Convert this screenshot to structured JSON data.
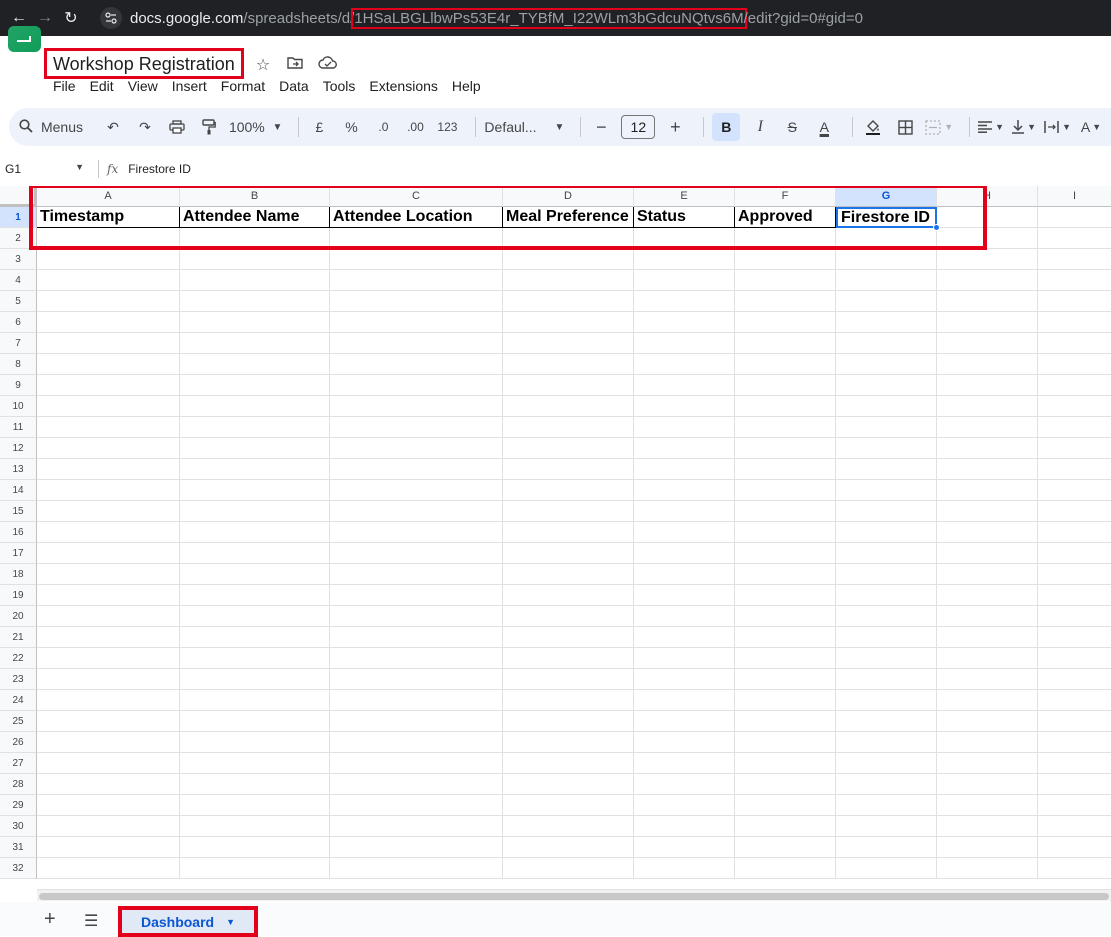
{
  "browser": {
    "url_host": "docs.google.com",
    "url_path_prefix": "/spreadsheets/d/",
    "url_doc_id": "1HSaLBGLlbwPs53E4r_TYBfM_I22WLm3bGdcuNQtvs6M",
    "url_suffix": "/edit?gid=0#gid=0"
  },
  "doc": {
    "title": "Workshop Registration"
  },
  "menu": [
    "File",
    "Edit",
    "View",
    "Insert",
    "Format",
    "Data",
    "Tools",
    "Extensions",
    "Help"
  ],
  "toolbar": {
    "menus_label": "Menus",
    "zoom": "100%",
    "currency": "£",
    "percent": "%",
    "dec_decrease": ".0",
    "dec_increase": ".00",
    "number_format": "123",
    "font": "Defaul...",
    "font_size": "12",
    "bold": "B",
    "italic": "I",
    "strike": "S",
    "text_color": "A"
  },
  "formula_bar": {
    "cell_ref": "G1",
    "fx": "fx",
    "content": "Firestore ID"
  },
  "columns": [
    "A",
    "B",
    "C",
    "D",
    "E",
    "F",
    "G",
    "H",
    "I"
  ],
  "selected_column": "G",
  "rows": [
    "1",
    "2",
    "3",
    "4",
    "5",
    "6",
    "7",
    "8",
    "9",
    "10",
    "11",
    "12",
    "13",
    "14",
    "15",
    "16",
    "17",
    "18",
    "19",
    "20",
    "21",
    "22",
    "23",
    "24",
    "25",
    "26",
    "27",
    "28",
    "29",
    "30",
    "31",
    "32"
  ],
  "header_row": [
    "Timestamp",
    "Attendee Name",
    "Attendee Location",
    "Meal Preference",
    "Status",
    "Approved",
    "Firestore ID"
  ],
  "sheet": {
    "tab_label": "Dashboard"
  },
  "colors": {
    "highlight": "#e3001b",
    "accent": "#1a73e8",
    "selected_bg": "#d3e3fd"
  }
}
